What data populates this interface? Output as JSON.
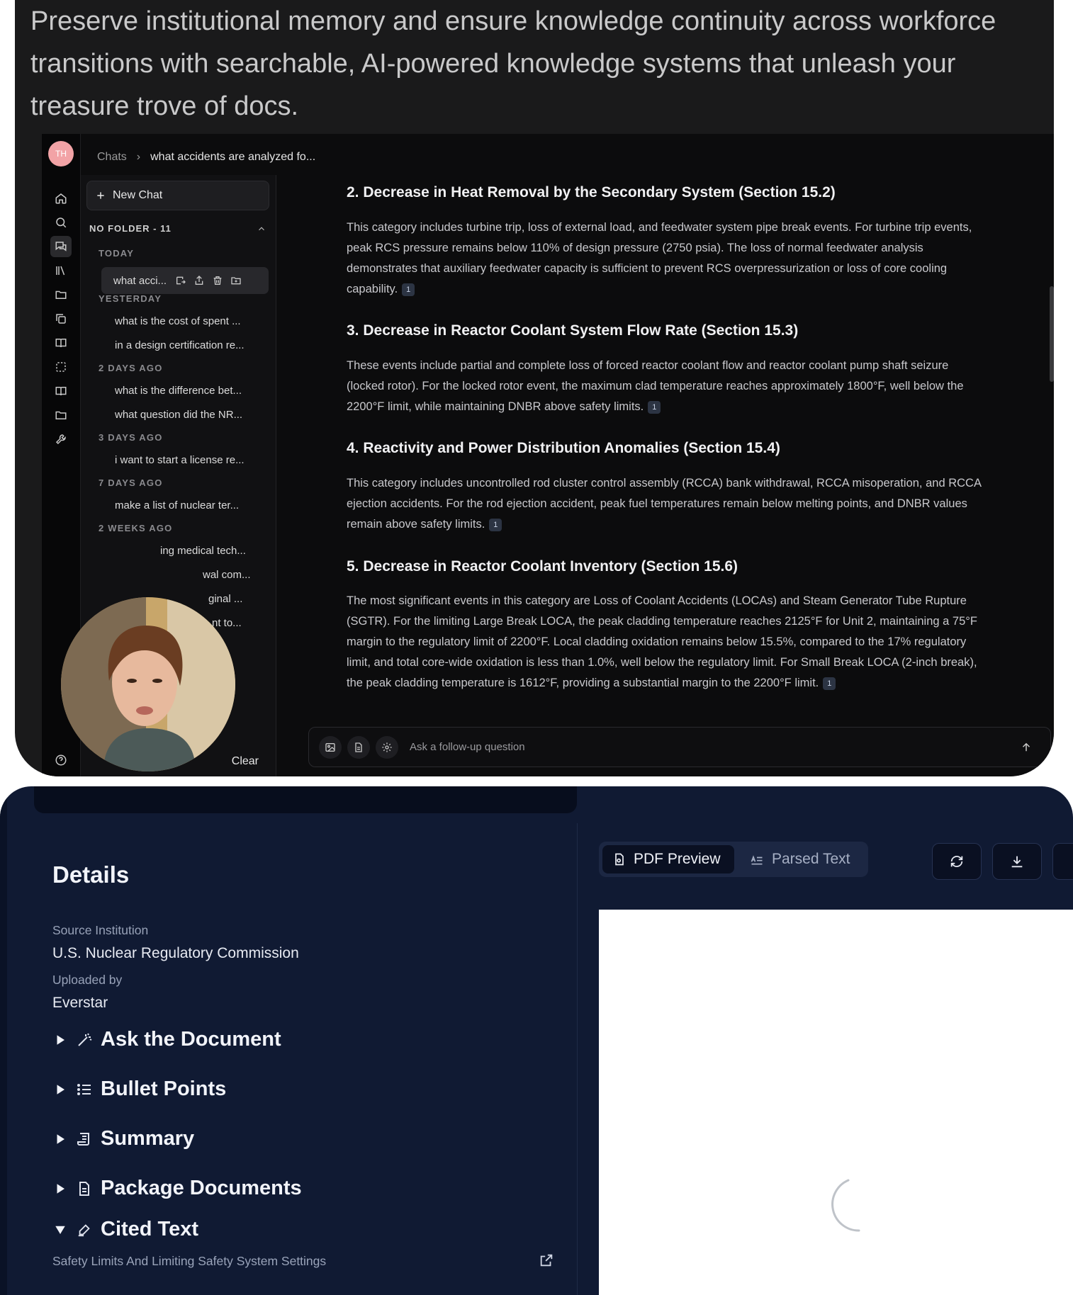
{
  "tagline": "Preserve institutional memory and ensure knowledge continuity across workforce transitions with searchable, AI-powered knowledge systems that unleash your treasure trove of docs.",
  "user": {
    "initials": "TH"
  },
  "breadcrumb": {
    "root": "Chats",
    "current": "what accidents are analyzed fo..."
  },
  "sidebar": {
    "new_chat_label": "New Chat",
    "folder_label": "NO FOLDER - 11",
    "groups": {
      "today": "TODAY",
      "yesterday": "YESTERDAY",
      "two_days": "2 DAYS AGO",
      "three_days": "3 DAYS AGO",
      "seven_days": "7 DAYS AGO",
      "two_weeks": "2 WEEKS AGO"
    },
    "active_chat": "what acci...",
    "chats": {
      "y1": "what is the cost of spent ...",
      "y2": "in a design certification re...",
      "d2a": "what is the difference bet...",
      "d2b": "what question did the NR...",
      "d3a": "i want to start a license re...",
      "d7a": "make a list of nuclear ter...",
      "w2a": "ing medical tech...",
      "w2b": "wal com...",
      "w2c": "ginal ...",
      "w2d": "nt to..."
    },
    "clear_label": "Clear"
  },
  "answer": {
    "sections": [
      {
        "title": "2. Decrease in Heat Removal by the Secondary System (Section 15.2)",
        "body": "This category includes turbine trip, loss of external load, and feedwater system pipe break events. For turbine trip events, peak RCS pressure remains below 110% of design pressure (2750 psia). The loss of normal feedwater analysis demonstrates that auxiliary feedwater capacity is sufficient to prevent RCS overpressurization or loss of core cooling capability.",
        "cite": "1"
      },
      {
        "title": "3. Decrease in Reactor Coolant System Flow Rate (Section 15.3)",
        "body": "These events include partial and complete loss of forced reactor coolant flow and reactor coolant pump shaft seizure (locked rotor). For the locked rotor event, the maximum clad temperature reaches approximately 1800°F, well below the 2200°F limit, while maintaining DNBR above safety limits.",
        "cite": "1"
      },
      {
        "title": "4. Reactivity and Power Distribution Anomalies (Section 15.4)",
        "body": "This category includes uncontrolled rod cluster control assembly (RCCA) bank withdrawal, RCCA misoperation, and RCCA ejection accidents. For the rod ejection accident, peak fuel temperatures remain below melting points, and DNBR values remain above safety limits.",
        "cite": "1"
      },
      {
        "title": "5. Decrease in Reactor Coolant Inventory (Section 15.6)",
        "body": "The most significant events in this category are Loss of Coolant Accidents (LOCAs) and Steam Generator Tube Rupture (SGTR). For the limiting Large Break LOCA, the peak cladding temperature reaches 2125°F for Unit 2, maintaining a 75°F margin to the regulatory limit of 2200°F. Local cladding oxidation remains below 15.5%, compared to the 17% regulatory limit, and total core-wide oxidation is less than 1.0%, well below the regulatory limit. For Small Break LOCA (2-inch break), the peak cladding temperature is 1612°F, providing a substantial margin to the 2200°F limit.",
        "cite": "1"
      }
    ]
  },
  "followup": {
    "placeholder": "Ask a follow-up question"
  },
  "details": {
    "title": "Details",
    "source_label": "Source Institution",
    "source_value": "U.S. Nuclear Regulatory Commission",
    "uploaded_label": "Uploaded by",
    "uploaded_value": "Everstar",
    "sections": {
      "ask": "Ask the Document",
      "bullets": "Bullet Points",
      "summary": "Summary",
      "package": "Package Documents",
      "cited": "Cited Text"
    },
    "cited_item": "Safety Limits And Limiting Safety System Settings"
  },
  "preview": {
    "tab_pdf": "PDF Preview",
    "tab_parsed": "Parsed Text"
  },
  "colors": {
    "top_bg": "#1a1a1b",
    "app_bg": "#0c0c0d",
    "bottom_bg": "#101a33",
    "avatar": "#f2a3a6",
    "cite_badge": "#2c3443"
  }
}
